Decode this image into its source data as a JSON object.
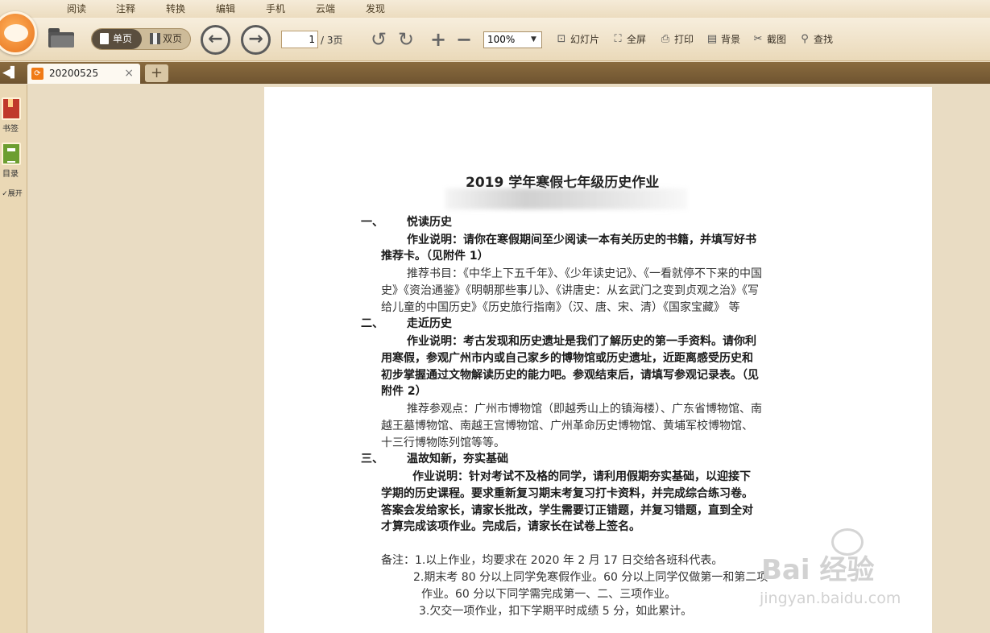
{
  "menu_tabs": [
    "阅读",
    "注释",
    "转换",
    "编辑",
    "手机",
    "云端",
    "发现"
  ],
  "toolbar": {
    "single_page": "单页",
    "double_page": "双页",
    "current_page": "1",
    "page_total": "/ 3页",
    "zoom": "100%",
    "slideshow": "幻灯片",
    "fullscreen": "全屏",
    "print": "打印",
    "background": "背景",
    "screenshot": "截图",
    "find": "查找"
  },
  "doc_tab": {
    "name": "20200525",
    "close": "×",
    "add": "+"
  },
  "sidebar": {
    "bookmark": "书签",
    "toc": "目录",
    "expand": "展开"
  },
  "document": {
    "title": "2019 学年寒假七年级历史作业",
    "s1_num": "一、",
    "s1_title": "悦读历史",
    "s1_desc_1": "作业说明：请你在寒假期间至少阅读一本有关历史的书籍，并填写好书",
    "s1_desc_2": "推荐卡。（见附件 1）",
    "s1_rec_1": "推荐书目：《中华上下五千年》、《少年读史记》、《一看就停不下来的中国",
    "s1_rec_2": "史》《资治通鉴》《明朝那些事儿》、《讲唐史：从玄武门之变到贞观之治》《写",
    "s1_rec_3": "给儿童的中国历史》《历史旅行指南》（汉、唐、宋、清）《国家宝藏》 等",
    "s2_num": "二、",
    "s2_title": "走近历史",
    "s2_desc_1": "作业说明：考古发现和历史遗址是我们了解历史的第一手资料。请你利",
    "s2_desc_2": "用寒假，参观广州市内或自己家乡的博物馆或历史遗址，近距离感受历史和",
    "s2_desc_3": "初步掌握通过文物解读历史的能力吧。参观结束后，请填写参观记录表。（见",
    "s2_desc_4": "附件 2）",
    "s2_rec_1": "推荐参观点：广州市博物馆（即越秀山上的镇海楼）、广东省博物馆、南",
    "s2_rec_2": "越王墓博物馆、南越王宫博物馆、广州革命历史博物馆、黄埔军校博物馆、",
    "s2_rec_3": "十三行博物陈列馆等等。",
    "s3_num": "三、",
    "s3_title": "温故知新，夯实基础",
    "s3_desc_1": "作业说明：针对考试不及格的同学，请利用假期夯实基础，以迎接下",
    "s3_desc_2": "学期的历史课程。要求重新复习期末考复习打卡资料，并完成综合练习卷。",
    "s3_desc_3": "答案会发给家长，请家长批改，学生需要订正错题，并复习错题，直到全对",
    "s3_desc_4": "才算完成该项作业。完成后，请家长在试卷上签名。",
    "note_1": "备注：1.以上作业，均要求在 2020 年 2 月 17 日交给各班科代表。",
    "note_2": "2.期末考 80 分以上同学免寒假作业。60 分以上同学仅做第一和第二项",
    "note_3": "作业。60 分以下同学需完成第一、二、三项作业。",
    "note_4": "3.欠交一项作业，扣下学期平时成绩 5 分，如此累计。"
  },
  "watermark": {
    "brand": "Bai  经验",
    "url": "jingyan.baidu.com"
  }
}
